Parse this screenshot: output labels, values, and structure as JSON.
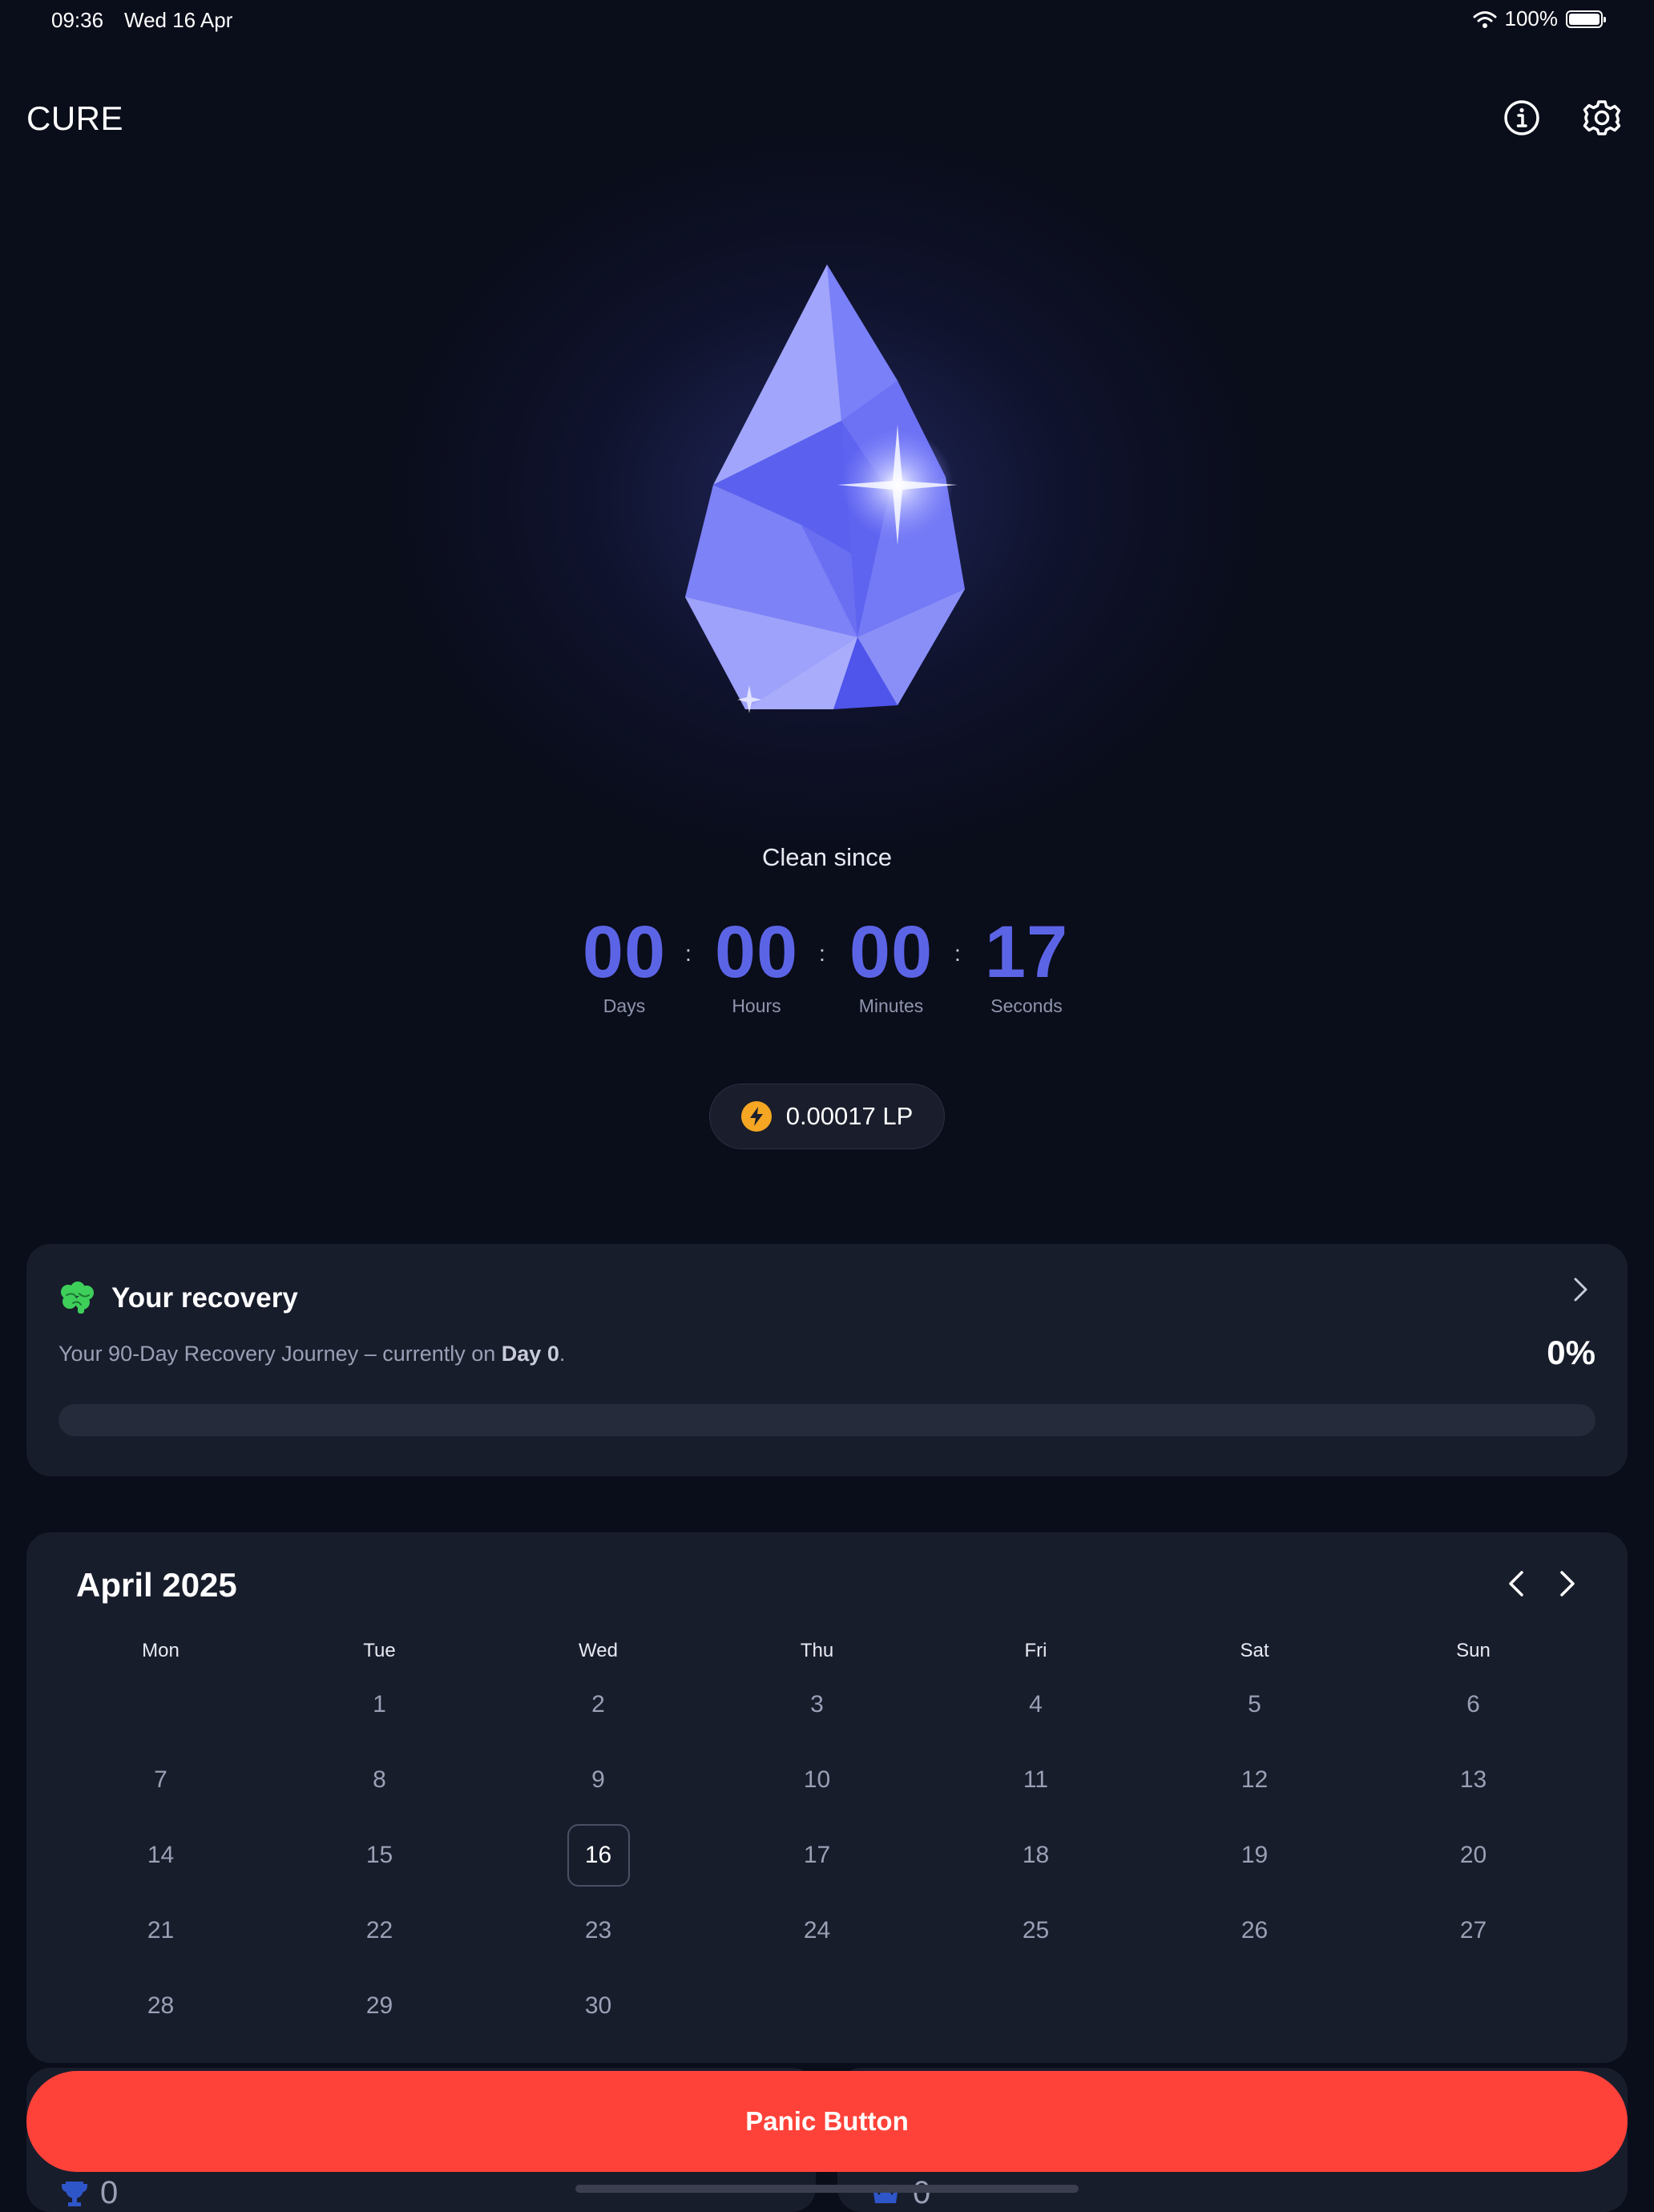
{
  "status_bar": {
    "time": "09:36",
    "date": "Wed 16 Apr",
    "battery": "100%"
  },
  "header": {
    "app_title": "CURE",
    "icons": [
      "info-icon",
      "gear-icon"
    ]
  },
  "hero": {
    "clean_since_label": "Clean since"
  },
  "timer": {
    "separator": ":",
    "days": {
      "value": "00",
      "label": "Days"
    },
    "hours": {
      "value": "00",
      "label": "Hours"
    },
    "minutes": {
      "value": "00",
      "label": "Minutes"
    },
    "seconds": {
      "value": "17",
      "label": "Seconds"
    }
  },
  "lp": {
    "value": "0.00017 LP",
    "icon": "lightning-icon"
  },
  "recovery": {
    "title": "Your recovery",
    "desc_prefix": "Your 90-Day Recovery Journey – currently on ",
    "desc_day": "Day 0",
    "desc_suffix": ".",
    "percent": "0%",
    "progress": 0
  },
  "calendar": {
    "month_title": "April 2025",
    "weekdays": [
      "Mon",
      "Tue",
      "Wed",
      "Thu",
      "Fri",
      "Sat",
      "Sun"
    ],
    "weeks": [
      [
        "",
        "1",
        "2",
        "3",
        "4",
        "5",
        "6"
      ],
      [
        "7",
        "8",
        "9",
        "10",
        "11",
        "12",
        "13"
      ],
      [
        "14",
        "15",
        "16",
        "17",
        "18",
        "19",
        "20"
      ],
      [
        "21",
        "22",
        "23",
        "24",
        "25",
        "26",
        "27"
      ],
      [
        "28",
        "29",
        "30",
        "",
        "",
        "",
        ""
      ]
    ],
    "today": "16"
  },
  "stats": {
    "left_value": "0",
    "right_value": "0"
  },
  "panic_button": {
    "label": "Panic Button"
  },
  "colors": {
    "accent": "#5c64e6",
    "panic": "#ff4239",
    "lp_icon": "#f5a623",
    "recovery_icon": "#3ecf5a"
  }
}
